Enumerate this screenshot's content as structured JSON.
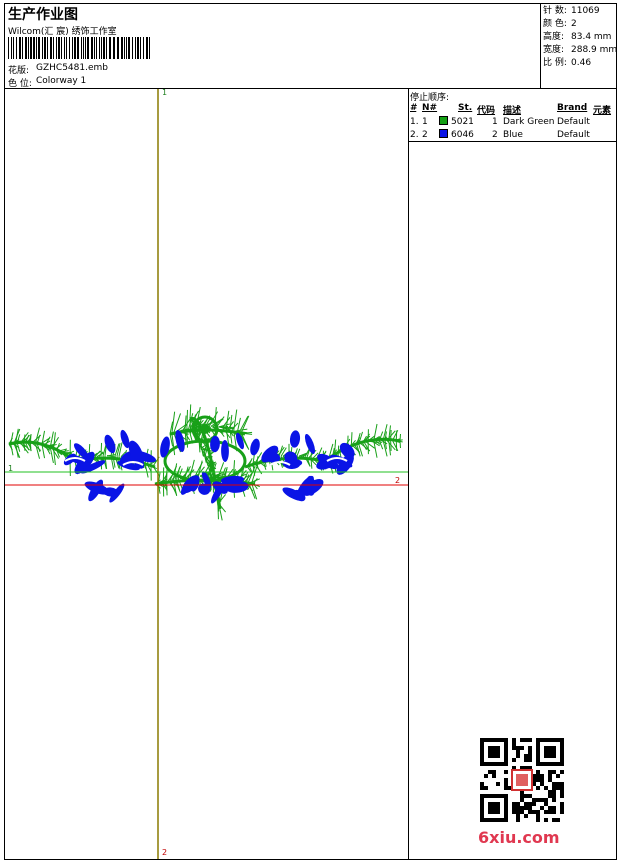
{
  "header": {
    "title": "生产作业图",
    "company": "Wilcom(汇 宸) 绣饰工作室",
    "design_label": "花版:",
    "design_value": "GZHC5481.emb",
    "colorway_label": "色 位:",
    "colorway_value": "Colorway 1"
  },
  "stats": [
    {
      "label": "针 数:",
      "value": "11069"
    },
    {
      "label": "颜 色:",
      "value": "2"
    },
    {
      "label": "高度:",
      "value": "83.4 mm"
    },
    {
      "label": "宽度:",
      "value": "288.9 mm"
    },
    {
      "label": "比 例:",
      "value": "0.46"
    }
  ],
  "stop_sequence": {
    "title": "停止顺序:",
    "headers": {
      "num": "#",
      "n": "N#",
      "st": "St.",
      "code": "代码",
      "desc": "描述",
      "brand": "Brand",
      "elements": "元素"
    },
    "rows": [
      {
        "num": "1.",
        "n": "1",
        "st": "5021",
        "code": "1",
        "desc": "Dark Green",
        "brand": "Default",
        "color": "#14a014"
      },
      {
        "num": "2.",
        "n": "2",
        "st": "6046",
        "code": "2",
        "desc": "Blue",
        "brand": "Default",
        "color": "#0a14e6"
      }
    ]
  },
  "axis_markers": {
    "top": "1",
    "bottom": "2",
    "left": "1",
    "right": "2"
  },
  "colors": {
    "thread_green": "#18a018",
    "thread_blue": "#0a14e6",
    "axis_vertical": "#8a7a00",
    "axis_red": "#e00000",
    "axis_green": "#20c020"
  },
  "watermark": "6xiu.com"
}
